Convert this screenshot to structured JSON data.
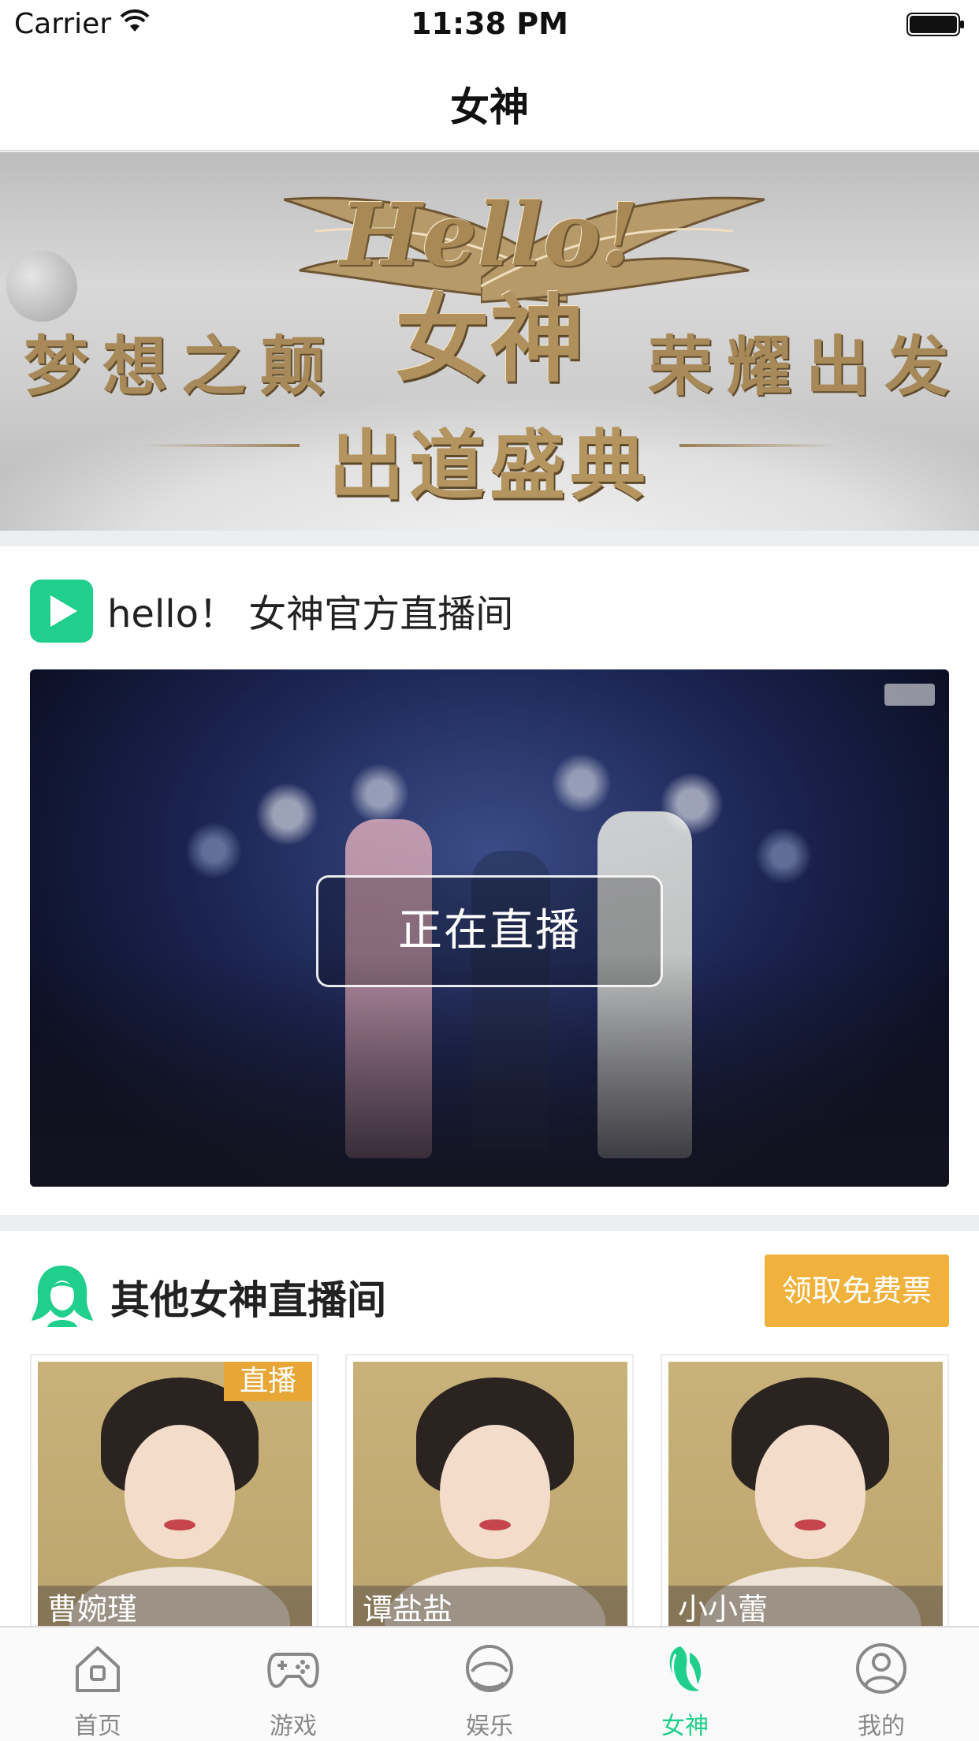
{
  "status_bar": {
    "carrier": "Carrier",
    "time": "11:38 PM"
  },
  "nav": {
    "title": "女神"
  },
  "banner": {
    "hello_text": "Hello!",
    "goddess_text": "女神",
    "left_text": "梦想之颠",
    "right_text": "荣耀出发",
    "bottom_text": "出道盛典"
  },
  "official": {
    "title": "hello！  女神官方直播间",
    "live_button": "正在直播"
  },
  "others": {
    "title": "其他女神直播间",
    "ticket_button": "领取免费票",
    "cards": [
      {
        "name": "曹婉瑾",
        "badge": "直播"
      },
      {
        "name": "谭盐盐",
        "badge": ""
      },
      {
        "name": "小小蕾",
        "badge": ""
      }
    ]
  },
  "tabs": [
    {
      "label": "首页",
      "icon": "home-icon"
    },
    {
      "label": "游戏",
      "icon": "gamepad-icon"
    },
    {
      "label": "娱乐",
      "icon": "entertainment-icon"
    },
    {
      "label": "女神",
      "icon": "goddess-icon",
      "active": true
    },
    {
      "label": "我的",
      "icon": "profile-icon"
    }
  ],
  "colors": {
    "accent": "#1fcf8b",
    "ticket": "#f0b23c",
    "live_badge": "#e8a637"
  }
}
